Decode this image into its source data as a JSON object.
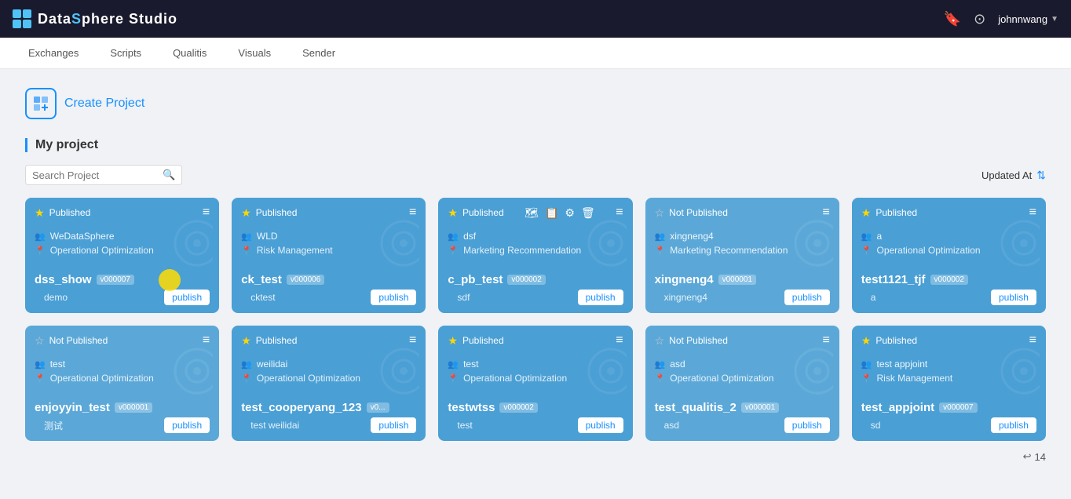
{
  "topnav": {
    "title_part1": "Data",
    "title_s": "S",
    "title_part2": "phere Studio",
    "user": "johnnwang",
    "icons": [
      "bookmark-icon",
      "github-icon"
    ]
  },
  "subnav": {
    "items": [
      "Exchanges",
      "Scripts",
      "Qualitis",
      "Visuals",
      "Sender"
    ]
  },
  "create_project": {
    "label": "Create Project"
  },
  "my_project": {
    "title": "My project",
    "search_placeholder": "Search Project",
    "sort_label": "Updated At",
    "total_count": "14"
  },
  "cards_row1": [
    {
      "status": "Published",
      "published": true,
      "user": "WeDataSphere",
      "category": "Operational Optimization",
      "name": "dss_show",
      "version": "v000007",
      "owner": "demo",
      "has_cursor": true
    },
    {
      "status": "Published",
      "published": true,
      "user": "WLD",
      "category": "Risk Management",
      "name": "ck_test",
      "version": "v000006",
      "owner": "cktest",
      "has_cursor": false
    },
    {
      "status": "Published",
      "published": true,
      "user": "dsf",
      "category": "Marketing Recommendation",
      "name": "c_pb_test",
      "version": "v000002",
      "owner": "sdf",
      "has_cursor": false,
      "has_extra_icons": true
    },
    {
      "status": "Not Published",
      "published": false,
      "user": "xingneng4",
      "category": "Marketing Recommendation",
      "name": "xingneng4",
      "version": "v000001",
      "owner": "xingneng4",
      "has_cursor": false
    },
    {
      "status": "Published",
      "published": true,
      "user": "a",
      "category": "Operational Optimization",
      "name": "test1121_tjf",
      "version": "v000002",
      "owner": "a",
      "has_cursor": false
    }
  ],
  "cards_row2": [
    {
      "status": "Not Published",
      "published": false,
      "user": "test",
      "category": "Operational Optimization",
      "name": "enjoyyin_test",
      "version": "v000001",
      "owner": "测试",
      "has_cursor": false
    },
    {
      "status": "Published",
      "published": true,
      "user": "weilidai",
      "category": "Operational Optimization",
      "name": "test_cooperyang_123",
      "version": "v0...",
      "owner": "test weilidai",
      "has_cursor": false
    },
    {
      "status": "Published",
      "published": true,
      "user": "test",
      "category": "Operational Optimization",
      "name": "testwtss",
      "version": "v000002",
      "owner": "test",
      "has_cursor": false
    },
    {
      "status": "Not Published",
      "published": false,
      "user": "asd",
      "category": "Operational Optimization",
      "name": "test_qualitis_2",
      "version": "v000001",
      "owner": "asd",
      "has_cursor": false
    },
    {
      "status": "Published",
      "published": true,
      "user": "test appjoint",
      "category": "Risk Management",
      "name": "test_appjoint",
      "version": "v000007",
      "owner": "sd",
      "has_cursor": false
    }
  ]
}
